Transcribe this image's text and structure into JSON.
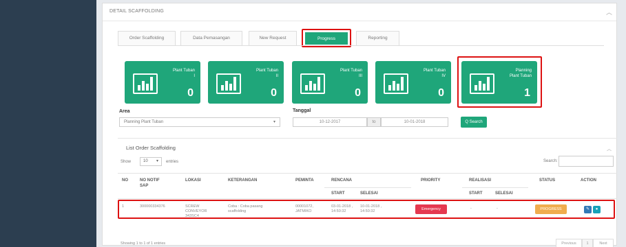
{
  "panel": {
    "title": "DETAIL SCAFFOLDING",
    "close_icon": "chevron-up-icon"
  },
  "tabs": [
    {
      "label": "Order Scaffolding",
      "active": false
    },
    {
      "label": "Data Pemasangan",
      "active": false
    },
    {
      "label": "New Request",
      "active": false
    },
    {
      "label": "Progress",
      "active": true
    },
    {
      "label": "Reporting",
      "active": false
    }
  ],
  "cards": [
    {
      "label": "Plant Tuban\nI",
      "count": "0",
      "icon": "bar-chart-icon"
    },
    {
      "label": "Plant Tuban\nII",
      "count": "0",
      "icon": "bar-chart-icon"
    },
    {
      "label": "Plant Tuban\nIII",
      "count": "0",
      "icon": "bar-chart-icon"
    },
    {
      "label": "Plant Tuban\nIV",
      "count": "0",
      "icon": "bar-chart-icon"
    },
    {
      "label": "Planning\nPlant Tuban",
      "count": "1",
      "icon": "bar-chart-icon"
    }
  ],
  "filters": {
    "area_label": "Area",
    "area_value": "Planning Plant Tuban",
    "tanggal_label": "Tanggal",
    "date_from": "10-12-2017",
    "to_label": "to",
    "date_to": "10-01-2018",
    "search_button": "Q Search"
  },
  "list": {
    "title": "List Order Scaffolding",
    "show_label": "Show",
    "show_value": "10",
    "entries_label": "entries",
    "search_label": "Search:",
    "headers": {
      "no": "NO",
      "no_notif": "NO NOTIF\nSAP",
      "lokasi": "LOKASI",
      "keterangan": "KETERANGAN",
      "peminta": "PEMINTA",
      "rencana": "RENCANA",
      "rencana_start": "START",
      "rencana_selesai": "SELESAI",
      "priority": "PRIORITY",
      "realisasi": "REALISASI",
      "realisasi_start": "START",
      "realisasi_selesai": "SELESAI",
      "status": "STATUS",
      "action": "ACTION"
    },
    "rows": [
      {
        "no": "1",
        "no_notif": "300000334376",
        "lokasi": "SCREW\nCONVEYOR\n343SC4",
        "keterangan": "Coba : Coba pasang\nscaffolding",
        "peminta": "00001072,\nJATMIKO",
        "rencana_start": "03-01-2018 ,\n14:50:32",
        "rencana_selesai": "10-01-2018 ,\n14:50:32",
        "priority": "Emergency",
        "realisasi_start": "-",
        "realisasi_selesai": "-",
        "status": "PROGRESS"
      }
    ],
    "footer": "Showing 1 to 1 of 1 entries",
    "pager": {
      "previous": "Previous",
      "page": "1",
      "next": "Next"
    }
  },
  "colors": {
    "accent": "#1fa67a",
    "sidebar": "#2c3e50",
    "emergency": "#e53950",
    "progress": "#f0ad4e",
    "highlight": "#d11111"
  }
}
